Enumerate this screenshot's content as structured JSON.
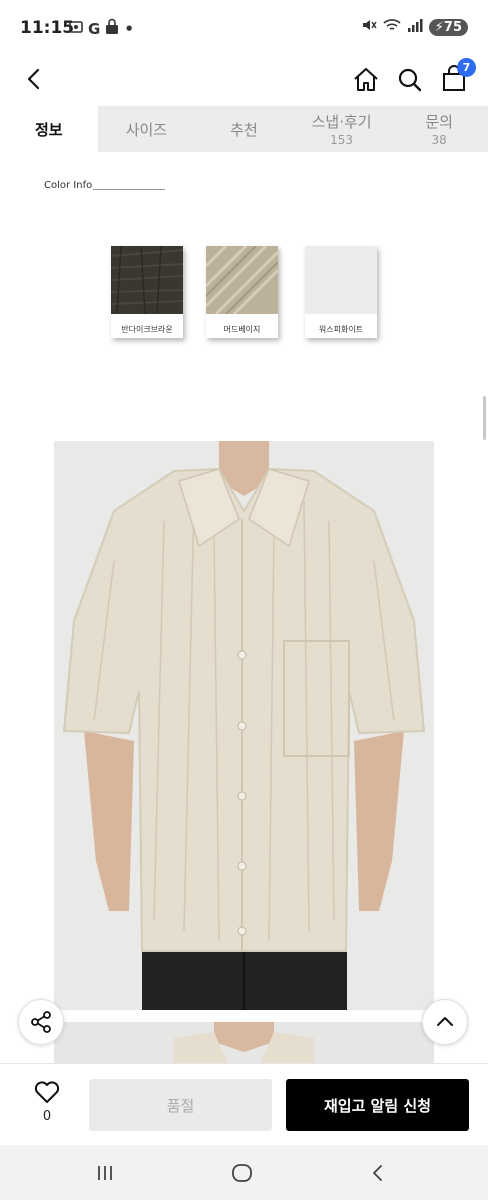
{
  "status_bar": {
    "time": "11:15",
    "left_icons": [
      "screenshot-icon",
      "google-icon",
      "lock-icon",
      "dot-icon"
    ],
    "google_letter": "G",
    "dot": "•",
    "battery": "75",
    "right_icons": [
      "mute-icon",
      "wifi-icon",
      "signal-icon",
      "battery-icon"
    ]
  },
  "top_nav": {
    "cart_count": "7"
  },
  "tabs": [
    {
      "label": "정보",
      "count": "",
      "active": true
    },
    {
      "label": "사이즈",
      "count": "",
      "active": false
    },
    {
      "label": "추천",
      "count": "",
      "active": false
    },
    {
      "label": "스냅·후기",
      "count": "153",
      "active": false
    },
    {
      "label": "문의",
      "count": "38",
      "active": false
    }
  ],
  "color_info": {
    "title": "Color Info",
    "swatches": [
      {
        "label": "반다이크브라운",
        "color": "#3a3630"
      },
      {
        "label": "머드베이지",
        "color": "#bcb29b"
      },
      {
        "label": "워스피화이트",
        "color": "#ececec"
      }
    ]
  },
  "bottom_bar": {
    "like_count": "0",
    "soldout_label": "품절",
    "restock_label": "재입고 알림 신청"
  },
  "colors": {
    "accent": "#2d6bf0",
    "tab_bg": "#ececec",
    "cta": "#000000"
  }
}
